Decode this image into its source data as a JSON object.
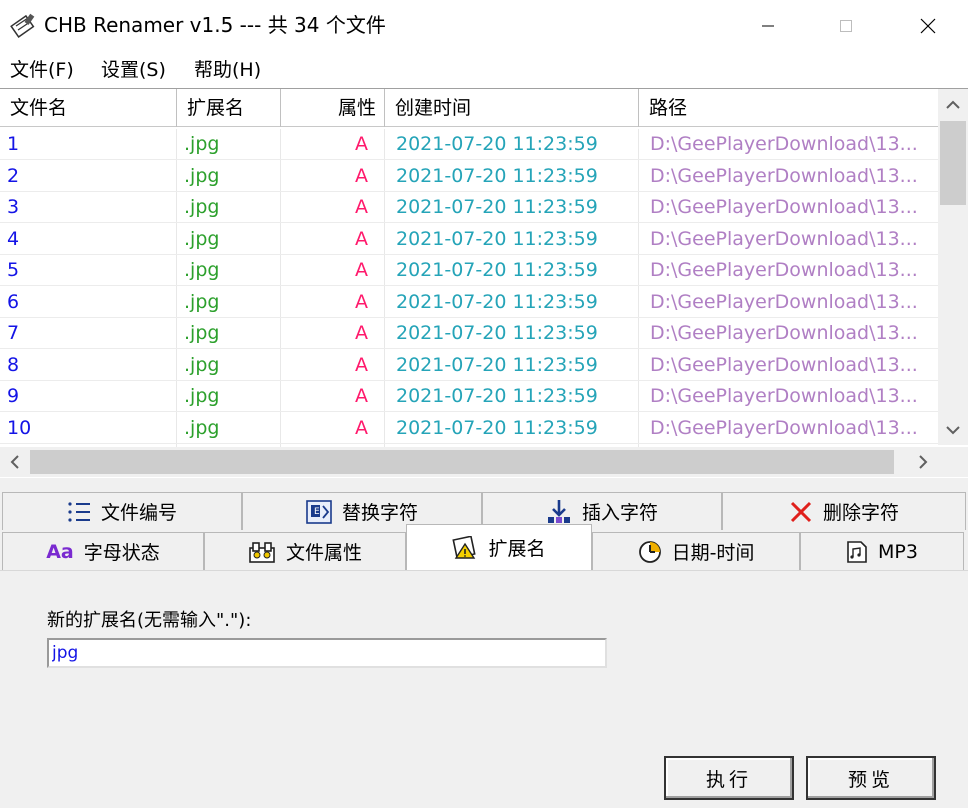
{
  "window": {
    "title": "CHB Renamer v1.5 --- 共 34 个文件"
  },
  "menu": {
    "items": [
      "文件(F)",
      "设置(S)",
      "帮助(H)"
    ]
  },
  "list": {
    "columns": [
      "文件名",
      "扩展名",
      "属性",
      "创建时间",
      "路径"
    ],
    "rows": [
      {
        "name": "1",
        "ext": ".jpg",
        "attr": "A",
        "time": "2021-07-20 11:23:59",
        "path": "D:\\GeePlayerDownload\\13..."
      },
      {
        "name": "2",
        "ext": ".jpg",
        "attr": "A",
        "time": "2021-07-20 11:23:59",
        "path": "D:\\GeePlayerDownload\\13..."
      },
      {
        "name": "3",
        "ext": ".jpg",
        "attr": "A",
        "time": "2021-07-20 11:23:59",
        "path": "D:\\GeePlayerDownload\\13..."
      },
      {
        "name": "4",
        "ext": ".jpg",
        "attr": "A",
        "time": "2021-07-20 11:23:59",
        "path": "D:\\GeePlayerDownload\\13..."
      },
      {
        "name": "5",
        "ext": ".jpg",
        "attr": "A",
        "time": "2021-07-20 11:23:59",
        "path": "D:\\GeePlayerDownload\\13..."
      },
      {
        "name": "6",
        "ext": ".jpg",
        "attr": "A",
        "time": "2021-07-20 11:23:59",
        "path": "D:\\GeePlayerDownload\\13..."
      },
      {
        "name": "7",
        "ext": ".jpg",
        "attr": "A",
        "time": "2021-07-20 11:23:59",
        "path": "D:\\GeePlayerDownload\\13..."
      },
      {
        "name": "8",
        "ext": ".jpg",
        "attr": "A",
        "time": "2021-07-20 11:23:59",
        "path": "D:\\GeePlayerDownload\\13..."
      },
      {
        "name": "9",
        "ext": ".jpg",
        "attr": "A",
        "time": "2021-07-20 11:23:59",
        "path": "D:\\GeePlayerDownload\\13..."
      },
      {
        "name": "10",
        "ext": ".jpg",
        "attr": "A",
        "time": "2021-07-20 11:23:59",
        "path": "D:\\GeePlayerDownload\\13..."
      }
    ],
    "colors": {
      "name": "#1414e6",
      "ext": "#2ca02c",
      "attr": "#ff1a6c",
      "time": "#25a4b8",
      "path": "#b07fc4"
    }
  },
  "tabs": {
    "row1": [
      {
        "label": "文件编号",
        "icon": "numbered-list-icon"
      },
      {
        "label": "替换字符",
        "icon": "replace-icon"
      },
      {
        "label": "插入字符",
        "icon": "insert-icon"
      },
      {
        "label": "删除字符",
        "icon": "delete-x-icon"
      }
    ],
    "row2": [
      {
        "label": "字母状态",
        "icon": "letter-case-icon",
        "icon_text": "Aa"
      },
      {
        "label": "文件属性",
        "icon": "file-attributes-icon"
      },
      {
        "label": "扩展名",
        "icon": "extension-icon",
        "active": true
      },
      {
        "label": "日期-时间",
        "icon": "clock-icon"
      },
      {
        "label": "MP3",
        "icon": "mp3-icon"
      }
    ]
  },
  "extension_tab": {
    "label": "新的扩展名(无需输入\".\"):",
    "value": "jpg"
  },
  "buttons": {
    "execute": "执行",
    "preview": "预览"
  }
}
